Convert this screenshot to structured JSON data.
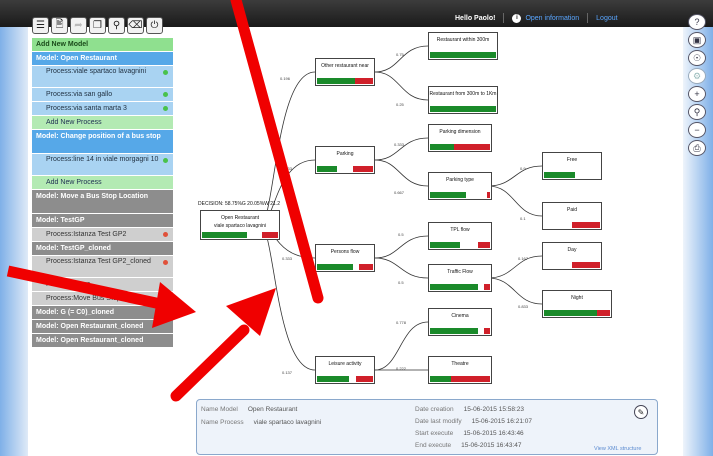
{
  "topbar": {
    "greeting": "Hello Paolo!",
    "info_label": "Open information",
    "info_icon": "info-icon",
    "logout_label": "Logout"
  },
  "toolbar": {
    "icons": [
      "menu-icon",
      "document-icon",
      "forward-icon",
      "copy-icon",
      "search-icon",
      "delete-icon",
      "power-icon"
    ]
  },
  "sidebar": {
    "add_model": "Add New Model",
    "model_open_restaurant": "Model: Open Restaurant",
    "proc_viale_spartaco": "Process:viale spartaco lavagnini",
    "proc_san_gallo": "Process:via san gallo",
    "proc_santa_marta": "Process:via santa marta 3",
    "add_process_1": "Add New Process",
    "model_change_bus": "Model: Change position of a bus stop",
    "proc_line14": "Process:line 14 in viale morgagni 10",
    "add_process_2": "Add New Process",
    "model_move_bus": "Model: Move a Bus Stop Location",
    "model_testgp": "Model: TestGP",
    "proc_istanza_gp2": "Process:Istanza Test GP2",
    "model_testgp_cloned": "Model: TestGP_cloned",
    "proc_istanza_cloned": "Process:Istanza Test GP2_cloned",
    "proc_move": "Process:Move",
    "proc_move_bus_stop": "Process:Move Bus Stop",
    "model_g_c0": "Model: G (= C0)_cloned",
    "model_open_rest_cloned_1": "Model: Open Restaurant_cloned",
    "model_open_rest_cloned_2": "Model: Open Restaurant_cloned"
  },
  "right_icons": [
    "help-icon",
    "window-icon",
    "target-icon",
    "settings-icon",
    "zoom-in-icon",
    "zoom-fit-icon",
    "zoom-out-icon",
    "print-icon"
  ],
  "diagram": {
    "decision_label": "DECISION: 58.75%G 20.05%W 21.2",
    "root": {
      "title": "Open Restaurant",
      "subtitle": "viale spartaco lavagnini"
    },
    "nodes": {
      "other_restaurant": "Other restaurant near",
      "within_300": "Restaurant within 300m",
      "from_300_1km": "Restaurant from 300m to 1Km",
      "parking": "Parking",
      "parking_dimension": "Parking dimension",
      "parking_type": "Parking type",
      "free": "Free",
      "paid": "Paid",
      "persons_flow": "Persons flow",
      "tpl_flow": "TPL flow",
      "traffic_flow": "Traffic Flow",
      "day": "Day",
      "night": "Night",
      "leisure": "Leisure activity",
      "cinema": "Cinema",
      "theatre": "Theatre"
    },
    "probs": {
      "p_other": "0.196",
      "p_within": "0.75",
      "p_from": "0.25",
      "p_parking": "0.333",
      "p_pdim": "0.333",
      "p_ptype": "0.667",
      "p_free": "0.9",
      "p_paid": "0.1",
      "p_persons": "0.333",
      "p_tpl": "0.5",
      "p_traffic": "0.5",
      "p_day": "0.167",
      "p_night": "0.833",
      "p_leisure": "0.137",
      "p_cinema": "0.778",
      "p_theatre": "0.222"
    }
  },
  "info_panel": {
    "name_model_key": "Name Model",
    "name_model_val": "Open Restaurant",
    "name_process_key": "Name Process",
    "name_process_val": "viale spartaco lavagnini",
    "date_creation_key": "Date creation",
    "date_creation_val": "15-06-2015 15:58:23",
    "date_modify_key": "Date last modify",
    "date_modify_val": "15-06-2015 16:21:07",
    "start_key": "Start execute",
    "start_val": "15-06-2015 16:43:46",
    "end_key": "End execute",
    "end_val": "15-06-2015 16:43:47",
    "view_xml": "View XML structure"
  }
}
